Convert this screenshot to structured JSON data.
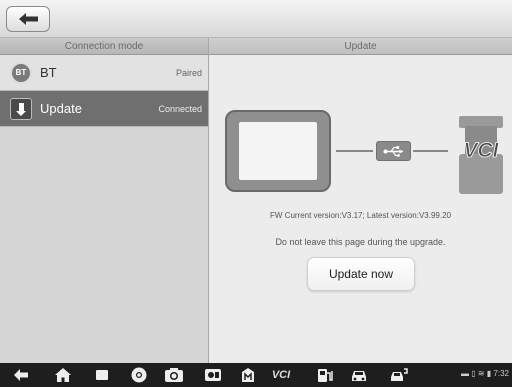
{
  "left_panel": {
    "header": "Connection mode",
    "items": [
      {
        "icon": "bluetooth-icon",
        "icon_text": "BT",
        "label": "BT",
        "status": "Paired",
        "selected": false
      },
      {
        "icon": "update-download-icon",
        "label": "Update",
        "status": "Connected",
        "selected": true
      }
    ]
  },
  "right_panel": {
    "header": "Update",
    "diagram": {
      "vci_label": "VCI"
    },
    "fw_text": "FW Current version:V3.17; Latest version:V3.99.20",
    "warning": "Do not leave this page during the upgrade.",
    "update_button": "Update now"
  },
  "navbar": {
    "vci_label": "VCI",
    "status_time": "7:32"
  },
  "colors": {
    "selected_row": "#6f6f6f",
    "navbar": "#1e1e1e",
    "panel_bg": "#ececec"
  }
}
